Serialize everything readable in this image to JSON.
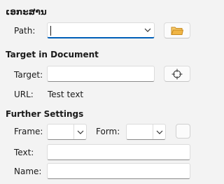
{
  "hyperlink": {
    "title": "ເອກະສານ",
    "path_label": "Path:",
    "path_value": "",
    "open_file_icon": "folder-icon"
  },
  "target_section": {
    "title": "Target in Document",
    "target_label": "Target:",
    "target_value": "",
    "target_icon": "crosshair-icon",
    "url_label": "URL:",
    "url_value": "Test text"
  },
  "further_settings": {
    "title": "Further Settings",
    "frame_label": "Frame:",
    "frame_value": "",
    "form_label": "Form:",
    "form_value": "",
    "text_label": "Text:",
    "text_value": "",
    "name_label": "Name:",
    "name_value": ""
  },
  "colors": {
    "accent": "#005fb8",
    "folder": "#e8a33c",
    "background": "#f3f3f3"
  }
}
